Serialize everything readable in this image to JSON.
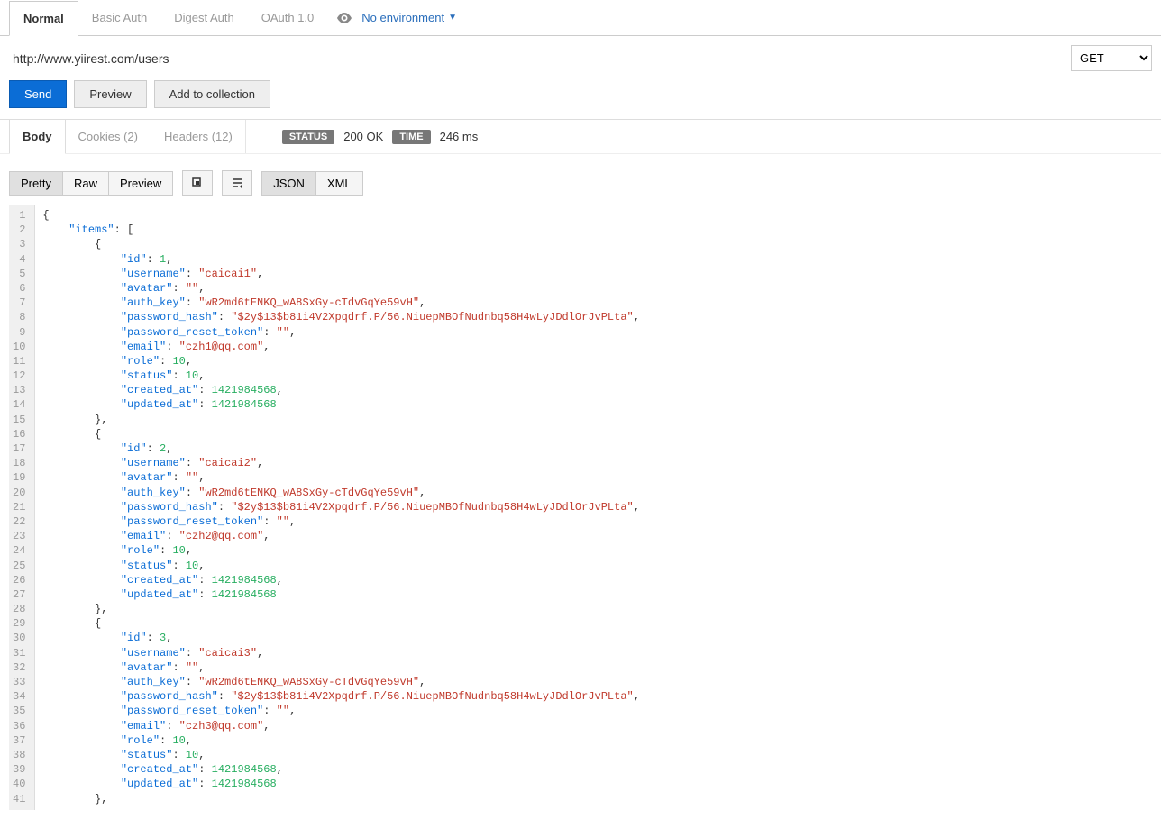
{
  "top_tabs": {
    "normal": "Normal",
    "basic": "Basic Auth",
    "digest": "Digest Auth",
    "oauth": "OAuth 1.0"
  },
  "environment": {
    "label": "No environment"
  },
  "url": "http://www.yiirest.com/users",
  "method": "GET",
  "buttons": {
    "send": "Send",
    "preview": "Preview",
    "add_collection": "Add to collection"
  },
  "response_tabs": {
    "body": "Body",
    "cookies": "Cookies (2)",
    "headers": "Headers (12)"
  },
  "status": {
    "status_label": "STATUS",
    "status_value": "200 OK",
    "time_label": "TIME",
    "time_value": "246 ms"
  },
  "format_tabs": {
    "pretty": "Pretty",
    "raw": "Raw",
    "preview": "Preview",
    "json": "JSON",
    "xml": "XML"
  },
  "response_body": {
    "items": [
      {
        "id": 1,
        "username": "caicai1",
        "avatar": "",
        "auth_key": "wR2md6tENKQ_wA8SxGy-cTdvGqYe59vH",
        "password_hash": "$2y$13$b81i4V2Xpqdrf.P/56.NiuepMBOfNudnbq58H4wLyJDdlOrJvPLta",
        "password_reset_token": "",
        "email": "czh1@qq.com",
        "role": 10,
        "status": 10,
        "created_at": 1421984568,
        "updated_at": 1421984568
      },
      {
        "id": 2,
        "username": "caicai2",
        "avatar": "",
        "auth_key": "wR2md6tENKQ_wA8SxGy-cTdvGqYe59vH",
        "password_hash": "$2y$13$b81i4V2Xpqdrf.P/56.NiuepMBOfNudnbq58H4wLyJDdlOrJvPLta",
        "password_reset_token": "",
        "email": "czh2@qq.com",
        "role": 10,
        "status": 10,
        "created_at": 1421984568,
        "updated_at": 1421984568
      },
      {
        "id": 3,
        "username": "caicai3",
        "avatar": "",
        "auth_key": "wR2md6tENKQ_wA8SxGy-cTdvGqYe59vH",
        "password_hash": "$2y$13$b81i4V2Xpqdrf.P/56.NiuepMBOfNudnbq58H4wLyJDdlOrJvPLta",
        "password_reset_token": "",
        "email": "czh3@qq.com",
        "role": 10,
        "status": 10,
        "created_at": 1421984568,
        "updated_at": 1421984568
      }
    ]
  }
}
